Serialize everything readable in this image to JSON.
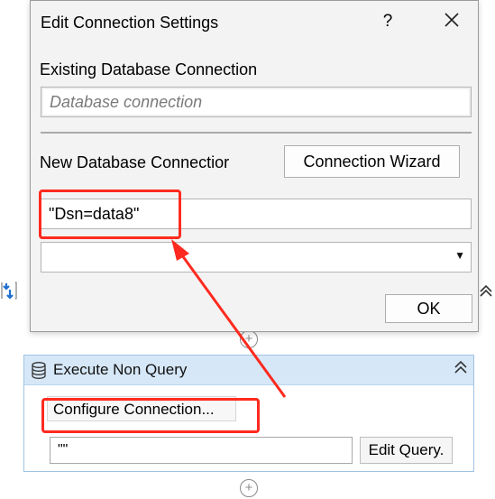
{
  "dialog": {
    "title": "Edit Connection Settings",
    "help_glyph": "?",
    "close_icon": "close-icon",
    "existing_label": "Existing Database Connection",
    "existing_placeholder": "Database connection",
    "new_label": "New Database Connectior",
    "wizard_button": "Connection Wizard",
    "connection_string": "\"Dsn=data8\"",
    "provider_value": "",
    "ok_button": "OK"
  },
  "activity": {
    "title": "Execute Non Query",
    "icon": "database-icon",
    "configure_button": "Configure Connection...",
    "query_value": "\"\"",
    "edit_query_button": "Edit Query."
  },
  "canvas": {
    "add_icon": "plus-circle-icon",
    "left_icon": "activity-icon",
    "collapse_icon": "double-chevron-up-icon"
  },
  "annotations": {
    "highlight_color": "#ff2a1f"
  }
}
